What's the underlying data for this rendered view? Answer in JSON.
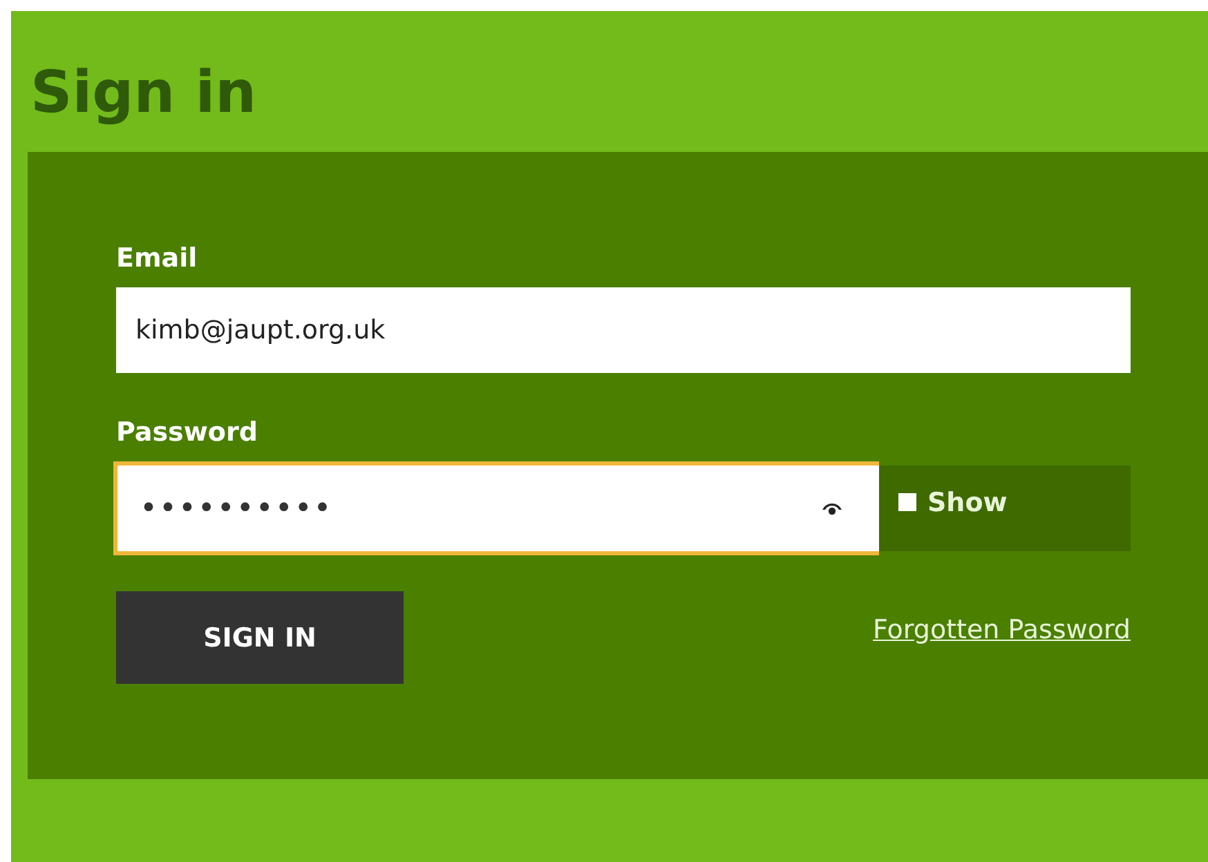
{
  "title": "Sign in",
  "form": {
    "email": {
      "label": "Email",
      "value": "kimb@jaupt.org.uk"
    },
    "password": {
      "label": "Password",
      "value": "••••••••••",
      "focused": true
    },
    "show": {
      "label": "Show",
      "checked": false
    },
    "submit": "SIGN IN",
    "forgot": "Forgotten Password"
  }
}
